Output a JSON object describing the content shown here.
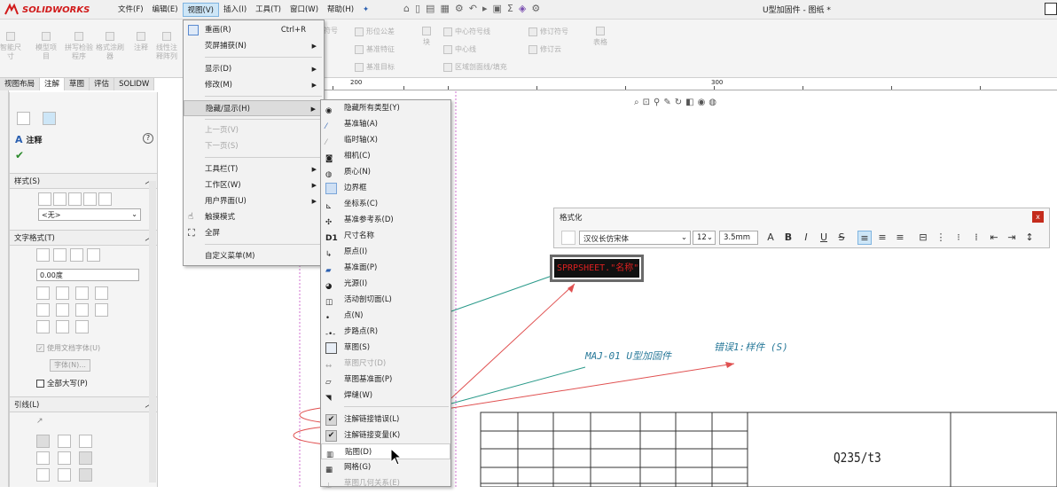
{
  "app": {
    "logo_text": "SOLIDWORKS",
    "document_title": "U型加固件 - 图纸 *"
  },
  "menubar": [
    "文件(F)",
    "编辑(E)",
    "视图(V)",
    "插入(I)",
    "工具(T)",
    "窗口(W)",
    "帮助(H)"
  ],
  "active_menu": "视图(V)",
  "ribbon": {
    "left_items": [
      "智能尺寸",
      "模型项目",
      "拼写检验程序",
      "格式涂刷器",
      "注释",
      "线性注释阵列"
    ],
    "rows": [
      [
        "形位公差",
        "中心符号线",
        "修订符号"
      ],
      [
        "基准特征",
        "中心线",
        "修订云"
      ],
      [
        "基准目标",
        "区域剖面线/填充"
      ]
    ],
    "right_labels": [
      "符号",
      "块",
      "表格"
    ]
  },
  "tabs": [
    "视图布局",
    "注解",
    "草图",
    "评估",
    "SOLIDW"
  ],
  "active_tab": "注解",
  "ruler_labels": [
    "200",
    "300"
  ],
  "panel": {
    "title": "注释",
    "sections": {
      "style": "样式(S)",
      "style_value": "<无>",
      "text_format": "文字格式(T)",
      "angle_value": "0.00度",
      "use_doc_font": "使用文档字体(U)",
      "font_button": "字体(N)...",
      "all_caps": "全部大写(P)",
      "leader": "引线(L)"
    }
  },
  "view_menu": {
    "items": [
      {
        "label": "重画(R)",
        "shortcut": "Ctrl+R",
        "icon": "redraw-icon"
      },
      {
        "label": "荧屏捕获(N)",
        "submenu": true
      },
      {
        "sep": true
      },
      {
        "label": "显示(D)",
        "submenu": true
      },
      {
        "label": "修改(M)",
        "submenu": true
      },
      {
        "sep": true
      },
      {
        "label": "隐藏/显示(H)",
        "submenu": true,
        "highlight": true
      },
      {
        "sep": true
      },
      {
        "label": "上一页(V)",
        "disabled": true
      },
      {
        "label": "下一页(S)",
        "disabled": true
      },
      {
        "sep": true
      },
      {
        "label": "工具栏(T)",
        "submenu": true
      },
      {
        "label": "工作区(W)",
        "submenu": true
      },
      {
        "label": "用户界面(U)",
        "submenu": true
      },
      {
        "label": "触摸模式",
        "icon": "touch-icon"
      },
      {
        "label": "全屏",
        "icon": "fullscreen-icon"
      },
      {
        "sep": true
      },
      {
        "label": "自定义菜单(M)"
      }
    ]
  },
  "hide_show_submenu": [
    {
      "label": "隐藏所有类型(Y)"
    },
    {
      "label": "基准轴(A)"
    },
    {
      "label": "临时轴(X)"
    },
    {
      "label": "相机(C)"
    },
    {
      "label": "质心(N)"
    },
    {
      "label": "边界框"
    },
    {
      "label": "坐标系(C)"
    },
    {
      "label": "基准参考系(D)"
    },
    {
      "label": "尺寸名称"
    },
    {
      "label": "原点(I)"
    },
    {
      "label": "基准面(P)"
    },
    {
      "label": "光源(I)"
    },
    {
      "label": "活动剖切面(L)"
    },
    {
      "label": "点(N)"
    },
    {
      "label": "步路点(R)"
    },
    {
      "label": "草图(S)"
    },
    {
      "label": "草图尺寸(D)",
      "disabled": true
    },
    {
      "label": "草图基准面(P)"
    },
    {
      "label": "焊缝(W)"
    },
    {
      "sep": true
    },
    {
      "label": "注解链接错误(L)",
      "checked": true
    },
    {
      "label": "注解链接变量(K)",
      "checked": true
    },
    {
      "label": "贴图(D)"
    },
    {
      "label": "网格(G)"
    },
    {
      "label": "草图几何关系(E)",
      "disabled": true
    }
  ],
  "format_toolbar": {
    "title": "格式化",
    "font": "汉仪长仿宋体",
    "size": "12",
    "height": "3.5mm"
  },
  "drawing": {
    "note_text": "SPRPSHEET.\"名称\"",
    "maj_text": "MAJ-01 U型加固件",
    "error_text": "错误1:样件 (S)",
    "material_text": "Q235/t3"
  },
  "colors": {
    "accent": "#d11a1a",
    "link_line": "#2a9a8a",
    "annotation_red": "#e05050"
  }
}
